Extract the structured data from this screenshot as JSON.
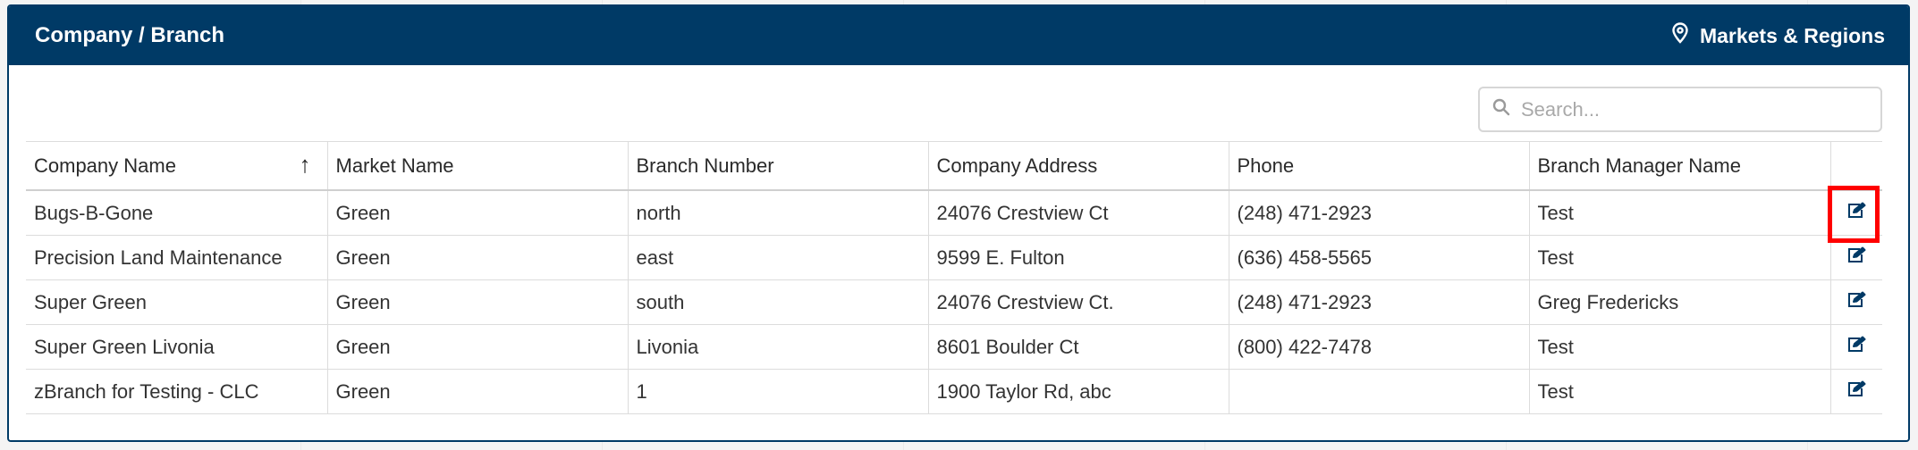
{
  "header": {
    "title": "Company / Branch",
    "markets_link_label": "Markets & Regions"
  },
  "search": {
    "placeholder": "Search...",
    "value": ""
  },
  "table": {
    "columns": [
      "Company Name",
      "Market Name",
      "Branch Number",
      "Company Address",
      "Phone",
      "Branch Manager Name"
    ],
    "sort_column": "Company Name",
    "sort_direction": "ascending",
    "rows": [
      [
        "Bugs-B-Gone",
        "Green",
        "north",
        "24076 Crestview Ct",
        "(248) 471-2923",
        "Test"
      ],
      [
        "Precision Land Maintenance",
        "Green",
        "east",
        "9599 E. Fulton",
        "(636) 458-5565",
        "Test"
      ],
      [
        "Super Green",
        "Green",
        "south",
        "24076 Crestview Ct.",
        "(248) 471-2923",
        "Greg Fredericks"
      ],
      [
        "Super Green Livonia",
        "Green",
        "Livonia",
        "8601 Boulder Ct",
        "(800) 422-7478",
        "Test"
      ],
      [
        "zBranch for Testing - CLC",
        "Green",
        "1",
        "1900 Taylor Rd, abc",
        "",
        "Test"
      ]
    ]
  },
  "icons": {
    "markets": "map-pin-icon",
    "search": "search-icon",
    "sort": "sort-up-arrow-icon",
    "edit": "edit-icon"
  },
  "colors": {
    "header_bg": "#003a66",
    "highlight": "#ff0000",
    "edit_icon": "#003a66"
  },
  "highlighted_row_index": 0
}
